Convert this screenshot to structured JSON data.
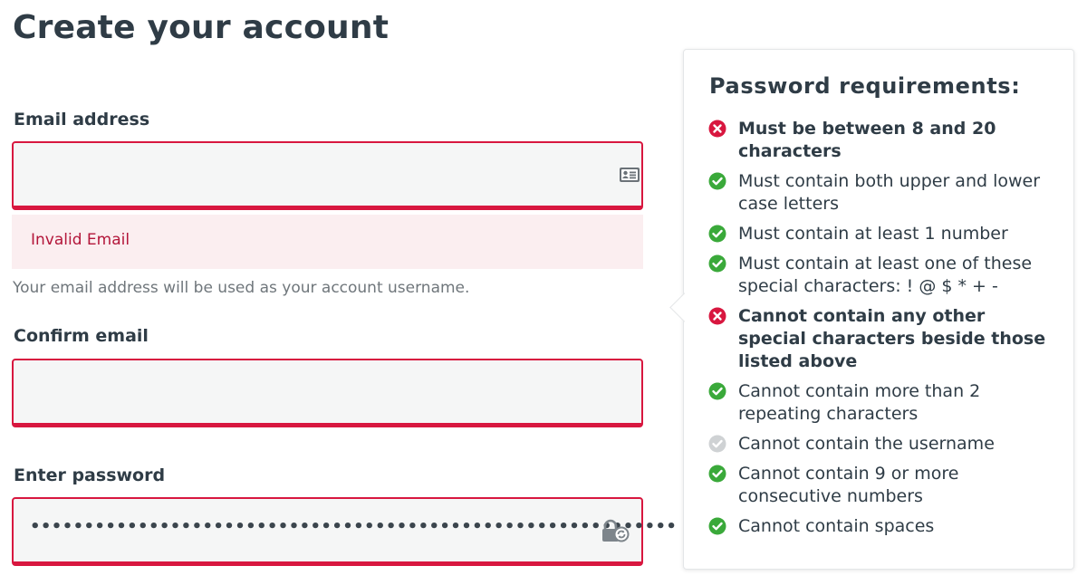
{
  "page": {
    "title": "Create your account"
  },
  "form": {
    "email": {
      "label": "Email address",
      "value": "",
      "placeholder": "",
      "error": "Invalid Email",
      "hint": "Your email address will be used as your account username.",
      "icon": "contact-card-icon"
    },
    "confirm_email": {
      "label": "Confirm email",
      "value": "",
      "placeholder": ""
    },
    "password": {
      "label": "Enter password",
      "masked_value": "••••••••••••••••••••••••••••••••••••••••••••••••••••••••••••",
      "icon": "password-lock-icon"
    }
  },
  "requirements": {
    "title": "Password requirements:",
    "items": [
      {
        "text": "Must be between 8 and 20 characters",
        "status": "fail"
      },
      {
        "text": "Must contain both upper and lower case letters",
        "status": "pass"
      },
      {
        "text": "Must contain at least 1 number",
        "status": "pass"
      },
      {
        "text": "Must contain at least one of these special characters: ! @ $ * + -",
        "status": "pass"
      },
      {
        "text": "Cannot contain any other special characters beside those listed above",
        "status": "fail"
      },
      {
        "text": "Cannot contain more than 2 repeating characters",
        "status": "pass"
      },
      {
        "text": "Cannot contain the username",
        "status": "neutral"
      },
      {
        "text": "Cannot contain 9 or more consecutive numbers",
        "status": "pass"
      },
      {
        "text": "Cannot contain spaces",
        "status": "pass"
      }
    ]
  },
  "colors": {
    "error": "#d8173f",
    "error_bg": "#fbeef0",
    "pass": "#3aa93a",
    "fail": "#d8173f",
    "neutral": "#cfd2d4",
    "text": "#2f3c46"
  }
}
